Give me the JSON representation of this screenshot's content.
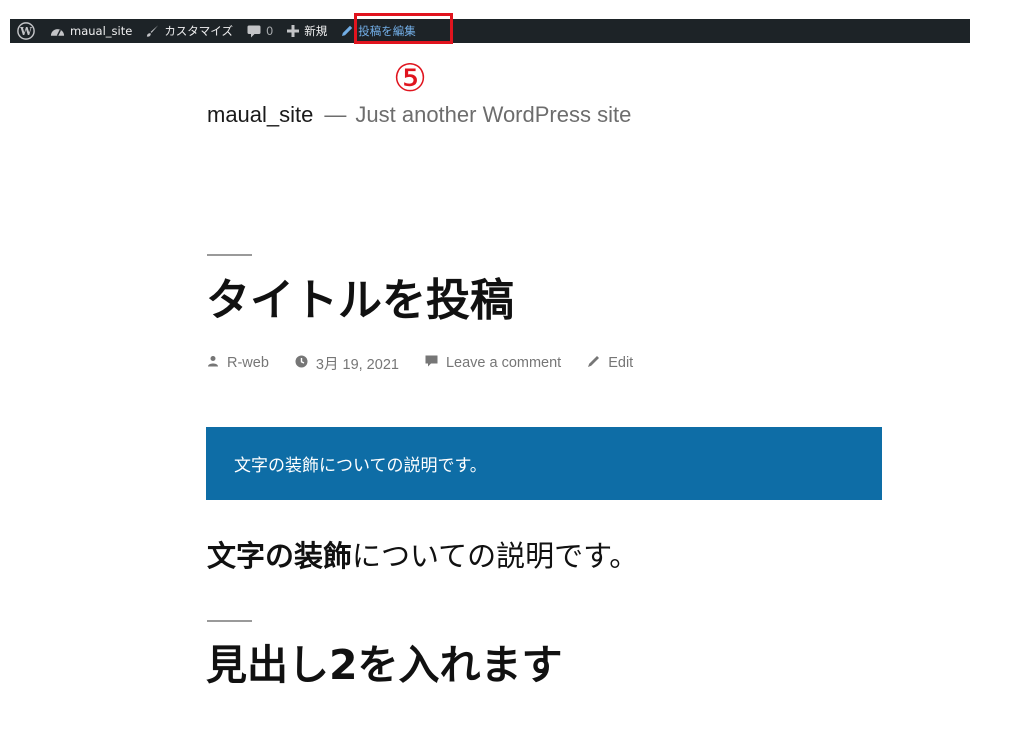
{
  "admin_bar": {
    "site_name": "maual_site",
    "customize_label": "カスタマイズ",
    "comments_count": "0",
    "new_label": "新規",
    "edit_post_label": "投稿を編集"
  },
  "annotation": {
    "step_marker": "⑤"
  },
  "site": {
    "title": "maual_site",
    "separator": "—",
    "description": "Just another WordPress site"
  },
  "post": {
    "title": "タイトルを投稿",
    "meta": {
      "author": "R-web",
      "date": "3月 19, 2021",
      "comments": "Leave a comment",
      "edit": "Edit"
    },
    "callout_text": "文字の装飾についての説明です。",
    "paragraph": {
      "bold": "文字の装飾",
      "rest": "についての説明です。"
    },
    "heading2": "見出し2を入れます"
  },
  "colors": {
    "admin_bar_bg": "#1d2327",
    "admin_link": "#72aee6",
    "highlight": "#e0141e",
    "callout_bg": "#0e6da6"
  }
}
